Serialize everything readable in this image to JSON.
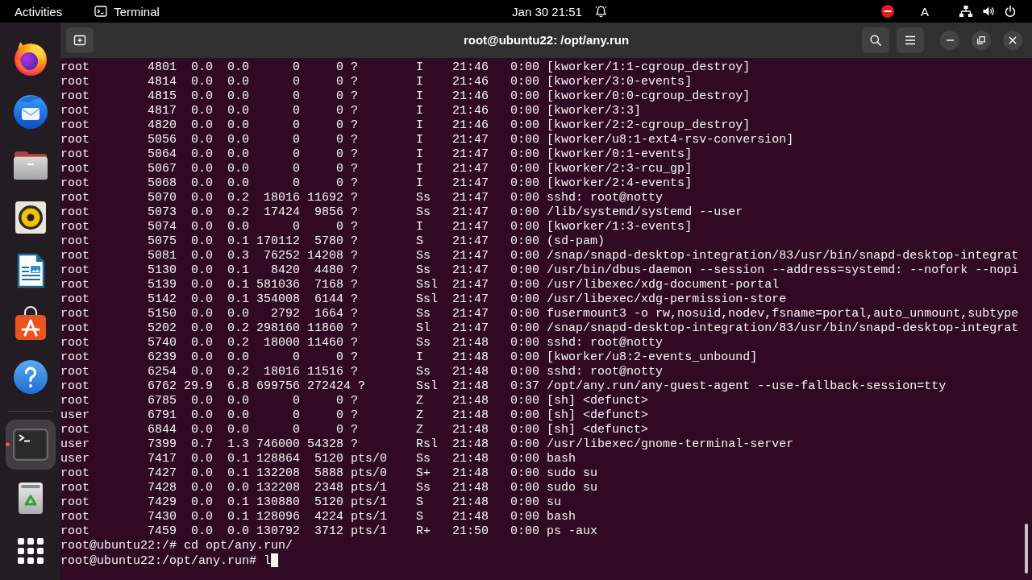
{
  "top_bar": {
    "activities": "Activities",
    "app_menu": "Terminal",
    "date": "Jan 30",
    "time": "21:51",
    "keyboard_layout": "A"
  },
  "dock": {
    "groups": [
      {
        "items": [
          {
            "kind": "browser",
            "running": false,
            "selected": false
          },
          {
            "kind": "mail",
            "running": false,
            "selected": false
          },
          {
            "kind": "files",
            "running": false,
            "selected": false
          },
          {
            "kind": "music",
            "running": false,
            "selected": false
          },
          {
            "kind": "writer",
            "running": false,
            "selected": false
          },
          {
            "kind": "store",
            "running": false,
            "selected": false
          },
          {
            "kind": "help",
            "running": false,
            "selected": false
          }
        ]
      },
      {
        "items": [
          {
            "kind": "terminal",
            "running": true,
            "selected": true
          },
          {
            "kind": "trash",
            "running": false,
            "selected": false
          }
        ]
      }
    ]
  },
  "window": {
    "title": "root@ubuntu22: /opt/any.run"
  },
  "terminal": {
    "lines": [
      "root        4801  0.0  0.0      0     0 ?        I    21:46   0:00 [kworker/1:1-cgroup_destroy]",
      "root        4814  0.0  0.0      0     0 ?        I    21:46   0:00 [kworker/3:0-events]",
      "root        4815  0.0  0.0      0     0 ?        I    21:46   0:00 [kworker/0:0-cgroup_destroy]",
      "root        4817  0.0  0.0      0     0 ?        I    21:46   0:00 [kworker/3:3]",
      "root        4820  0.0  0.0      0     0 ?        I    21:46   0:00 [kworker/2:2-cgroup_destroy]",
      "root        5056  0.0  0.0      0     0 ?        I    21:47   0:00 [kworker/u8:1-ext4-rsv-conversion]",
      "root        5064  0.0  0.0      0     0 ?        I    21:47   0:00 [kworker/0:1-events]",
      "root        5067  0.0  0.0      0     0 ?        I    21:47   0:00 [kworker/2:3-rcu_gp]",
      "root        5068  0.0  0.0      0     0 ?        I    21:47   0:00 [kworker/2:4-events]",
      "root        5070  0.0  0.2  18016 11692 ?        Ss   21:47   0:00 sshd: root@notty",
      "root        5073  0.0  0.2  17424  9856 ?        Ss   21:47   0:00 /lib/systemd/systemd --user",
      "root        5074  0.0  0.0      0     0 ?        I    21:47   0:00 [kworker/1:3-events]",
      "root        5075  0.0  0.1 170112  5780 ?        S    21:47   0:00 (sd-pam)",
      "root        5081  0.0  0.3  76252 14208 ?        Ss   21:47   0:00 /snap/snapd-desktop-integration/83/usr/bin/snapd-desktop-integrat",
      "root        5130  0.0  0.1   8420  4480 ?        Ss   21:47   0:00 /usr/bin/dbus-daemon --session --address=systemd: --nofork --nopi",
      "root        5139  0.0  0.1 581036  7168 ?        Ssl  21:47   0:00 /usr/libexec/xdg-document-portal",
      "root        5142  0.0  0.1 354008  6144 ?        Ssl  21:47   0:00 /usr/libexec/xdg-permission-store",
      "root        5150  0.0  0.0   2792  1664 ?        Ss   21:47   0:00 fusermount3 -o rw,nosuid,nodev,fsname=portal,auto_unmount,subtype",
      "root        5202  0.0  0.2 298160 11860 ?        Sl   21:47   0:00 /snap/snapd-desktop-integration/83/usr/bin/snapd-desktop-integrat",
      "root        5740  0.0  0.2  18000 11460 ?        Ss   21:48   0:00 sshd: root@notty",
      "root        6239  0.0  0.0      0     0 ?        I    21:48   0:00 [kworker/u8:2-events_unbound]",
      "root        6254  0.0  0.2  18016 11516 ?        Ss   21:48   0:00 sshd: root@notty",
      "root        6762 29.9  6.8 699756 272424 ?       Ssl  21:48   0:37 /opt/any.run/any-guest-agent --use-fallback-session=tty",
      "root        6785  0.0  0.0      0     0 ?        Z    21:48   0:00 [sh] <defunct>",
      "user        6791  0.0  0.0      0     0 ?        Z    21:48   0:00 [sh] <defunct>",
      "root        6844  0.0  0.0      0     0 ?        Z    21:48   0:00 [sh] <defunct>",
      "user        7399  0.7  1.3 746000 54328 ?        Rsl  21:48   0:00 /usr/libexec/gnome-terminal-server",
      "user        7417  0.0  0.1 128864  5120 pts/0    Ss   21:48   0:00 bash",
      "root        7427  0.0  0.1 132208  5888 pts/0    S+   21:48   0:00 sudo su",
      "root        7428  0.0  0.0 132208  2348 pts/1    Ss   21:48   0:00 sudo su",
      "root        7429  0.0  0.1 130880  5120 pts/1    S    21:48   0:00 su",
      "root        7430  0.0  0.1 128096  4224 pts/1    S    21:48   0:00 bash",
      "root        7459  0.0  0.0 130792  3712 pts/1    R+   21:50   0:00 ps -aux",
      "root@ubuntu22:/# cd opt/any.run/"
    ],
    "prompt_line": "root@ubuntu22:/opt/any.run# l"
  }
}
